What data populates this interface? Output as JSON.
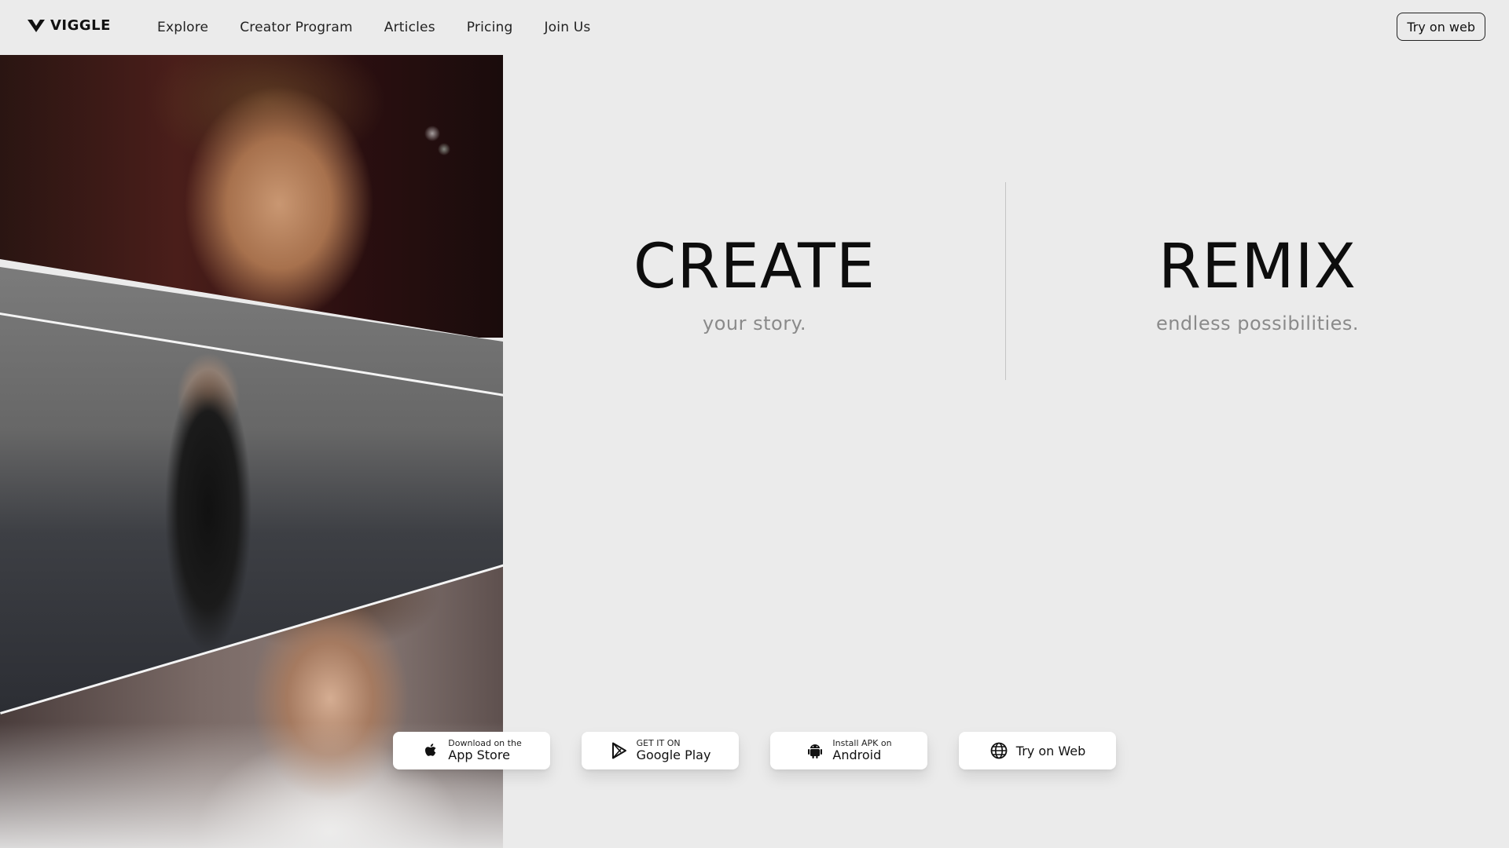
{
  "header": {
    "logo_text": "VIGGLE",
    "nav": [
      "Explore",
      "Creator Program",
      "Articles",
      "Pricing",
      "Join Us"
    ],
    "cta_label": "Try on web"
  },
  "hero": {
    "left": {
      "title": "CREATE",
      "subtitle": "your story."
    },
    "right": {
      "title": "REMIX",
      "subtitle": "endless possibilities."
    }
  },
  "downloads": {
    "app_store": {
      "small": "Download on the",
      "big": "App Store",
      "icon": "apple-icon"
    },
    "google_play": {
      "small": "GET IT ON",
      "big": "Google Play",
      "icon": "google-play-icon"
    },
    "android": {
      "small": "Install APK on",
      "big": "Android",
      "icon": "android-icon"
    },
    "web": {
      "label": "Try on Web",
      "icon": "globe-icon"
    }
  },
  "colors": {
    "background": "#ebebeb",
    "text": "#0d0d0d",
    "subtitle": "#8a8a8a",
    "button_bg": "#ffffff"
  }
}
